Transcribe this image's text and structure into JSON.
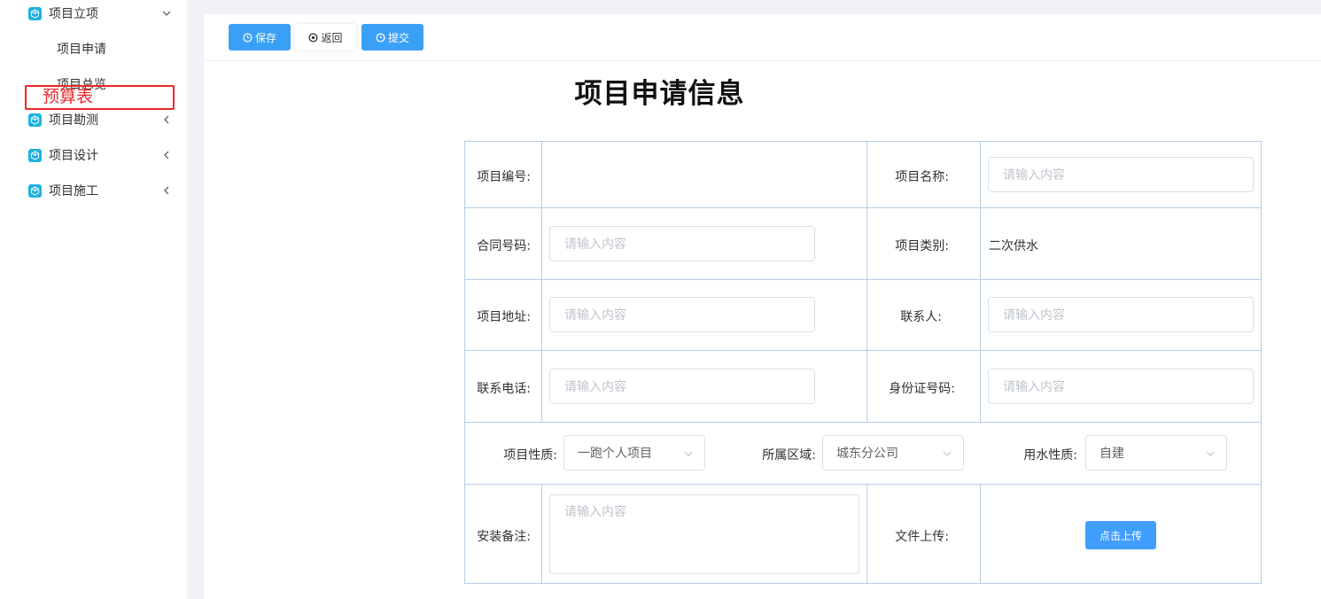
{
  "sidebar": {
    "groups": [
      {
        "label": "项目立项",
        "icon": "cube-icon",
        "arrow": "chevron-down-icon"
      },
      {
        "label": "项目勘测",
        "icon": "cube-icon",
        "arrow": "chevron-left-icon"
      },
      {
        "label": "项目设计",
        "icon": "cube-icon",
        "arrow": "chevron-left-icon"
      },
      {
        "label": "项目施工",
        "icon": "cube-icon",
        "arrow": "chevron-left-icon"
      }
    ],
    "sub_items": [
      {
        "label": "项目申请"
      },
      {
        "label": "项目总览"
      }
    ],
    "annotation": "预算表"
  },
  "toolbar": {
    "save_label": "保存",
    "back_label": "返回",
    "submit_label": "提交"
  },
  "form": {
    "title": "项目申请信息",
    "project_no_label": "项目编号:",
    "project_name_label": "项目名称:",
    "project_name_placeholder": "请输入内容",
    "contract_no_label": "合同号码:",
    "contract_no_placeholder": "请输入内容",
    "project_type_label": "项目类别:",
    "project_type_value": "二次供水",
    "address_label": "项目地址:",
    "address_placeholder": "请输入内容",
    "contact_label": "联系人:",
    "contact_placeholder": "请输入内容",
    "phone_label": "联系电话:",
    "phone_placeholder": "请输入内容",
    "id_no_label": "身份证号码:",
    "id_no_placeholder": "请输入内容",
    "nature_label": "项目性质:",
    "nature_value": "一跑个人项目",
    "region_label": "所属区域:",
    "region_value": "城东分公司",
    "water_label": "用水性质:",
    "water_value": "自建",
    "remark_label": "安装备注:",
    "remark_placeholder": "请输入内容",
    "upload_label": "文件上传:",
    "upload_button": "点击上传"
  },
  "colors": {
    "accent": "#409eff",
    "menu_icon": "#1fb1df",
    "annotation": "#e8292c",
    "table_border": "#b8cce4"
  }
}
